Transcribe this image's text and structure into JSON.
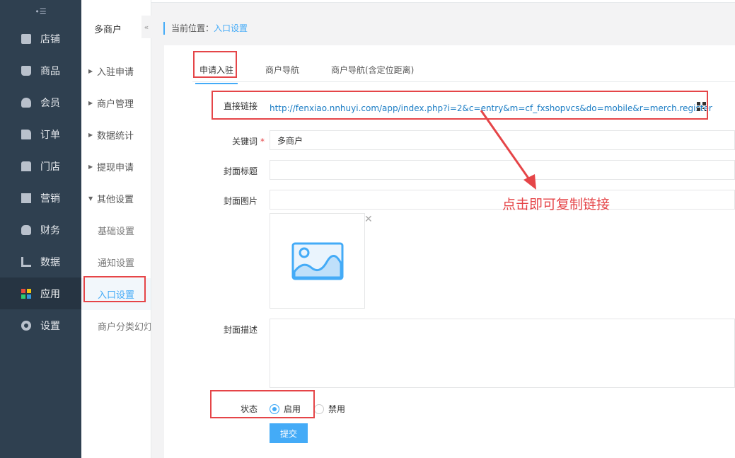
{
  "sidebar": {
    "collapse_icon": "menu-fold-icon",
    "items": [
      {
        "label": "店铺",
        "icon": "shop-icon"
      },
      {
        "label": "商品",
        "icon": "goods-icon"
      },
      {
        "label": "会员",
        "icon": "user-icon"
      },
      {
        "label": "订单",
        "icon": "order-icon"
      },
      {
        "label": "门店",
        "icon": "store-icon"
      },
      {
        "label": "营销",
        "icon": "gift-icon"
      },
      {
        "label": "财务",
        "icon": "money-bag-icon"
      },
      {
        "label": "数据",
        "icon": "chart-icon"
      },
      {
        "label": "应用",
        "icon": "apps-icon",
        "active": true
      },
      {
        "label": "设置",
        "icon": "gear-icon"
      }
    ]
  },
  "subnav": {
    "title": "多商户",
    "fold_icon": "double-chevron-left-icon",
    "groups": [
      {
        "label": "入驻申请",
        "expanded": false
      },
      {
        "label": "商户管理",
        "expanded": false
      },
      {
        "label": "数据统计",
        "expanded": false
      },
      {
        "label": "提现申请",
        "expanded": false
      },
      {
        "label": "其他设置",
        "expanded": true
      }
    ],
    "subitems": [
      {
        "label": "基础设置"
      },
      {
        "label": "通知设置"
      },
      {
        "label": "入口设置",
        "active": true
      },
      {
        "label": "商户分类幻灯"
      }
    ]
  },
  "breadcrumb": {
    "prefix": "当前位置：",
    "current": "入口设置"
  },
  "tabs": [
    {
      "label": "申请入驻",
      "active": true
    },
    {
      "label": "商户导航"
    },
    {
      "label": "商户导航(含定位距离)"
    }
  ],
  "form": {
    "direct_link_label": "直接链接",
    "direct_link_url": "http://fenxiao.nnhuyi.com/app/index.php?i=2&c=entry&m=cf_fxshopvcs&do=mobile&r=merch.register",
    "keyword_label": "关键词",
    "keyword_required": "*",
    "keyword_value": "多商户",
    "cover_title_label": "封面标题",
    "cover_title_value": "",
    "cover_image_label": "封面图片",
    "cover_image_value": "",
    "cover_desc_label": "封面描述",
    "cover_desc_value": "",
    "status_label": "状态",
    "status_options": [
      {
        "label": "启用",
        "checked": true
      },
      {
        "label": "禁用",
        "checked": false
      }
    ],
    "submit_label": "提交"
  },
  "annotation": {
    "text": "点击即可复制链接"
  },
  "colors": {
    "sidebar_bg": "#2f4050",
    "accent": "#44abf7",
    "highlight_red": "#e54548"
  }
}
